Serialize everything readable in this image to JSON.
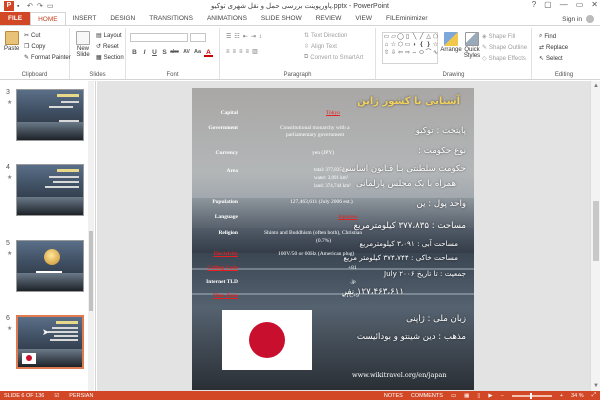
{
  "window": {
    "title": "پاورپوینت بررسی حمل و نقل شهری توکیو.pptx - PowerPoint",
    "app_logo": "P",
    "controls": [
      "?",
      "▢",
      "—",
      "▭",
      "✕"
    ]
  },
  "tabs": [
    {
      "label": "FILE"
    },
    {
      "label": "HOME"
    },
    {
      "label": "INSERT"
    },
    {
      "label": "DESIGN"
    },
    {
      "label": "TRANSITIONS"
    },
    {
      "label": "ANIMATIONS"
    },
    {
      "label": "SLIDE SHOW"
    },
    {
      "label": "REVIEW"
    },
    {
      "label": "VIEW"
    },
    {
      "label": "FILEminimizer"
    }
  ],
  "signin": "Sign in",
  "ribbon": {
    "clipboard": {
      "label": "Clipboard",
      "paste": "Paste",
      "cut": "Cut",
      "copy": "Copy",
      "format_painter": "Format Painter"
    },
    "slides": {
      "label": "Slides",
      "new_slide": "New Slide",
      "layout": "Layout",
      "reset": "Reset",
      "section": "Section"
    },
    "font": {
      "label": "Font",
      "buttons": [
        "B",
        "I",
        "U",
        "S",
        "abc",
        "AV",
        "Aa",
        "A"
      ]
    },
    "paragraph": {
      "label": "Paragraph",
      "text_direction": "Text Direction",
      "align_text": "Align Text",
      "convert_smartart": "Convert to SmartArt"
    },
    "drawing": {
      "label": "Drawing",
      "arrange": "Arrange",
      "quick_styles": "Quick Styles",
      "shape_fill": "Shape Fill",
      "shape_outline": "Shape Outline",
      "shape_effects": "Shape Effects",
      "shapes": [
        "▭",
        "▱",
        "◯",
        "▯",
        "╲",
        "╱",
        "△",
        "⬠",
        "⌂",
        "☆",
        "⬡",
        "▭",
        "◗",
        "❴",
        "❵",
        "☆",
        "⇧",
        "⇩",
        "⇦",
        "⇨",
        "⇔",
        "⬭",
        "⌒",
        "∿"
      ]
    },
    "editing": {
      "label": "Editing",
      "find": "Find",
      "replace": "Replace",
      "select": "Select"
    }
  },
  "thumbnails": [
    {
      "num": "3"
    },
    {
      "num": "4"
    },
    {
      "num": "5"
    },
    {
      "num": "6"
    }
  ],
  "slide": {
    "fa_title": "آشنایی با کشور ژاپن",
    "fa_lines": [
      "پایتخت :        توکیو",
      "نوع حکومت :",
      "حکومت سلطنتی بـا قـانون اساسی",
      "همراه با یک مجلس پارلمانی",
      "واحد پول :           ین",
      "مساحت : ۳۷۷،۸۳۵ کیلومترمربع",
      "مساحت آبی : ۳،۰۹۱ کیلومترمربع",
      "مساحت خاکی : ۳۷۴،۷۴۴ کیلومتر مربع",
      "جمعیت : تا تاریخ July ۲۰۰۶",
      "۱۲۷،۴۶۳،۶۱۱ نفر",
      "زبان ملی :              ژاپنی",
      "مذهب :   دین شینتو و بودائیست"
    ],
    "en": {
      "capital_label": "Capital",
      "capital_value": "Tokyo",
      "government_label": "Government",
      "government_value_1": "Constitutional monarchy with a",
      "government_value_2": "parliamentary government",
      "currency_label": "Currency",
      "currency_value": "yen (JPY)",
      "area_label": "Area",
      "area_total": "total: 377,835 km²",
      "area_water": "water: 3,091 km²",
      "area_land": "land: 374,744 km²",
      "population_label": "Population",
      "population_value": "127,463,611 (July 2006 est.)",
      "language_label": "Language",
      "language_value": "Japanese",
      "religion_label": "Religion",
      "religion_value_1": "Shinto and Buddhism (often both), Christian",
      "religion_value_2": "(0.7%)",
      "electricity_label": "Electricity",
      "electricity_value": "100V/50 or 60Hz (American plug)",
      "calling_label": "Calling Code",
      "calling_value": "+81",
      "tld_label": "Internet TLD",
      "tld_value": ".jp",
      "timezone_label": "Time Zone",
      "timezone_value": "UTC+9"
    },
    "url": "www.wikitravel.org/en/japan"
  },
  "status": {
    "slide_of": "SLIDE 6 OF 136",
    "language": "PERSIAN",
    "notes": "NOTES",
    "comments": "COMMENTS",
    "zoom": "34 %"
  },
  "colors": {
    "accent": "#d24726",
    "title_gold": "#f2d15c",
    "link_red": "#e52020"
  }
}
